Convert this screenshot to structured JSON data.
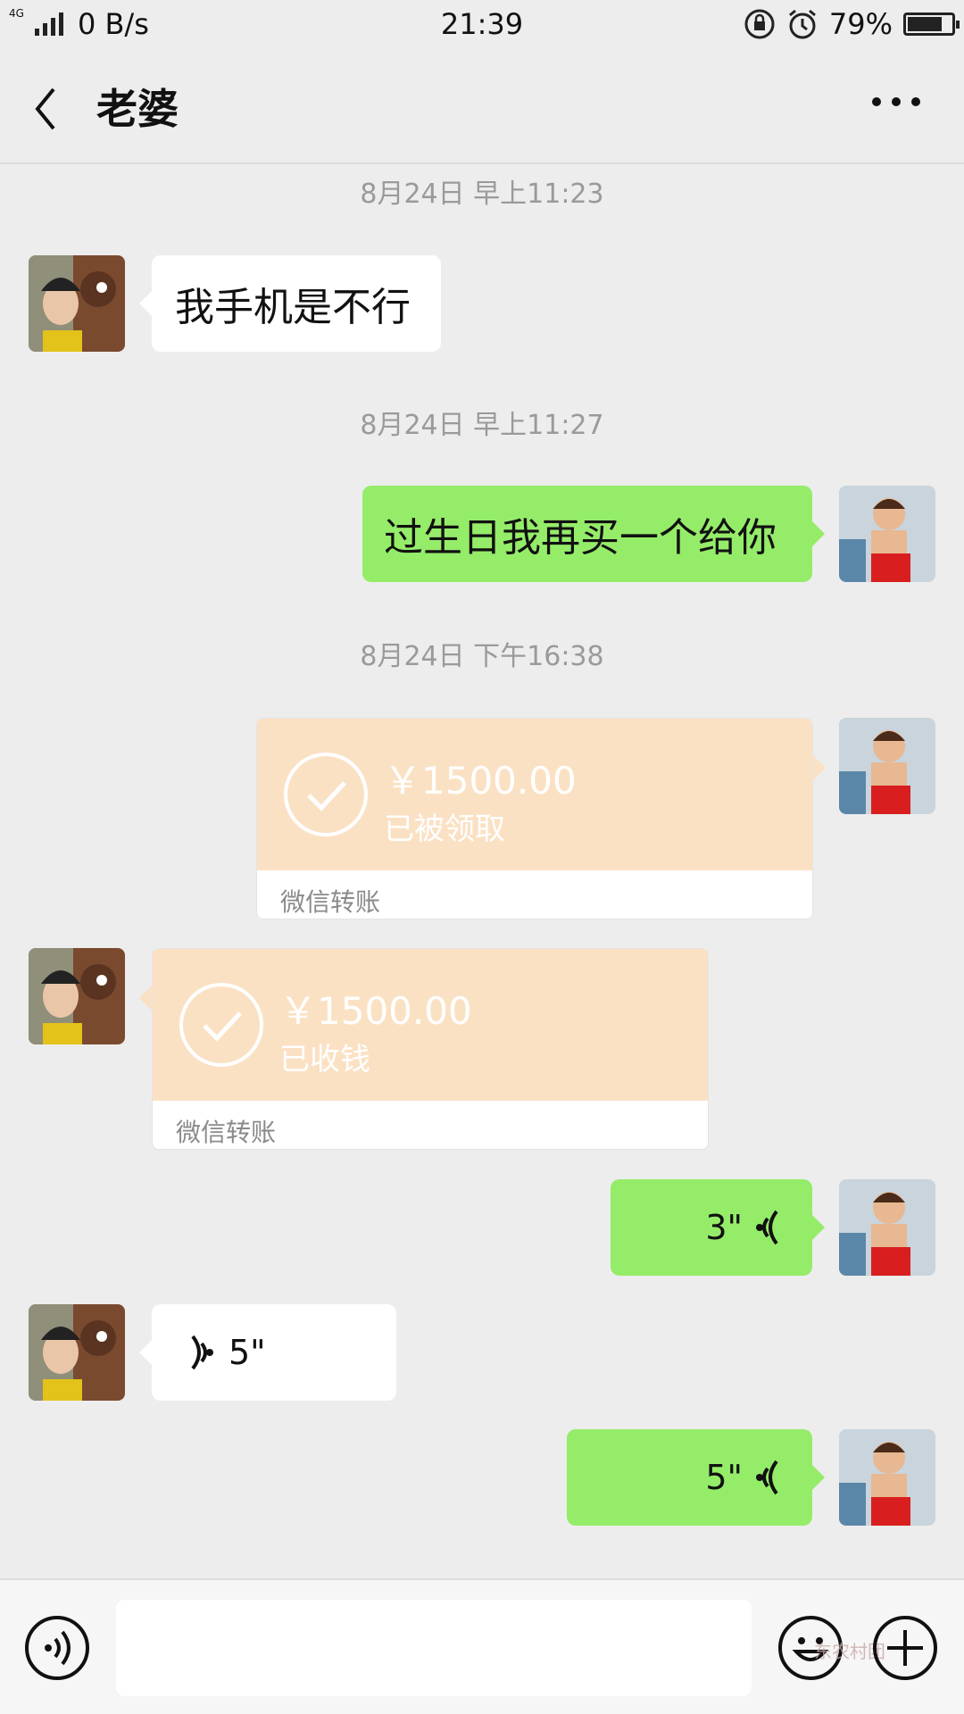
{
  "status": {
    "speed": "0 B/s",
    "network": "4G",
    "time": "21:39",
    "battery": "79%",
    "battery_level": 0.79
  },
  "header": {
    "title": "老婆"
  },
  "messages": {
    "ts1": "8月24日 早上11:23",
    "msg1": "我手机是不行",
    "ts2": "8月24日 早上11:27",
    "msg2": "过生日我再买一个给你",
    "ts3": "8月24日 下午16:38",
    "transfer1": {
      "amount": "￥1500.00",
      "state": "已被领取",
      "label": "微信转账"
    },
    "transfer2": {
      "amount": "￥1500.00",
      "state": "已收钱",
      "label": "微信转账"
    },
    "voice1": "3\"",
    "voice2": "5\"",
    "voice3": "5\""
  },
  "watermark": "东农村团",
  "colors": {
    "green_bubble": "#95ec69",
    "transfer_bg": "#fbe1c4",
    "background": "#ededed"
  },
  "icons": [
    "back-icon",
    "more-icon",
    "voice-mode-icon",
    "emoji-icon",
    "plus-icon",
    "check-icon",
    "voice-wave-icon"
  ]
}
